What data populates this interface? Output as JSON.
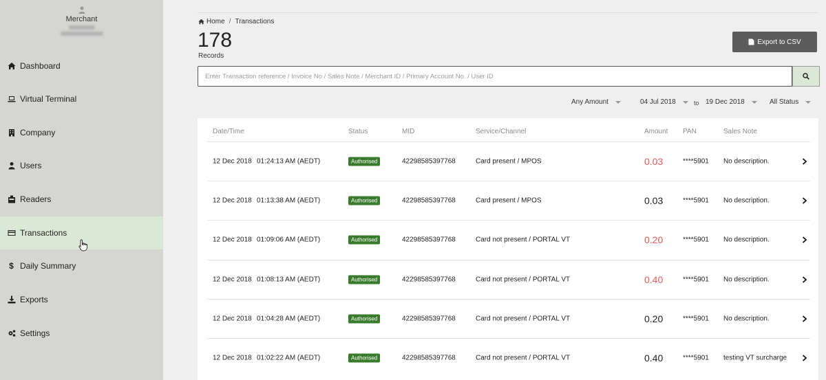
{
  "sidebar": {
    "merchant_title": "Merchant",
    "items": [
      {
        "label": "Dashboard",
        "icon": "home-icon",
        "active": false
      },
      {
        "label": "Virtual Terminal",
        "icon": "laptop-icon",
        "active": false
      },
      {
        "label": "Company",
        "icon": "building-icon",
        "active": false
      },
      {
        "label": "Users",
        "icon": "user-icon",
        "active": false
      },
      {
        "label": "Readers",
        "icon": "reader-icon",
        "active": false
      },
      {
        "label": "Transactions",
        "icon": "credit-card-icon",
        "active": true
      },
      {
        "label": "Daily Summary",
        "icon": "dollar-icon",
        "active": false
      },
      {
        "label": "Exports",
        "icon": "download-icon",
        "active": false
      },
      {
        "label": "Settings",
        "icon": "gears-icon",
        "active": false
      }
    ]
  },
  "breadcrumb": {
    "home": "Home",
    "current": "Transactions"
  },
  "records": {
    "count": "178",
    "label": "Records"
  },
  "export_label": "Export to CSV",
  "search": {
    "placeholder": "Enter Transaction reference / Invoice No / Sales Note / Merchant ID / Primary Account No. / User ID"
  },
  "filters": {
    "amount": "Any Amount",
    "date_from": "04 Jul 2018",
    "to": "to",
    "date_to": "19 Dec 2018",
    "status": "All Status"
  },
  "table": {
    "headers": {
      "datetime": "Date/Time",
      "status": "Status",
      "mid": "MID",
      "service": "Service/Channel",
      "amount": "Amount",
      "pan": "PAN",
      "note": "Sales Note"
    },
    "rows": [
      {
        "date": "12 Dec 2018",
        "time": "01:24:13 AM (AEDT)",
        "status": "Authorised",
        "mid": "42298585397768",
        "service": "Card present / MPOS",
        "amount": "0.03",
        "red": true,
        "pan": "****5901",
        "note": "No description."
      },
      {
        "date": "12 Dec 2018",
        "time": "01:13:38 AM (AEDT)",
        "status": "Authorised",
        "mid": "42298585397768",
        "service": "Card present / MPOS",
        "amount": "0.03",
        "red": false,
        "pan": "****5901",
        "note": "No description."
      },
      {
        "date": "12 Dec 2018",
        "time": "01:09:06 AM (AEDT)",
        "status": "Authorised",
        "mid": "42298585397768",
        "service": "Card not present / PORTAL VT",
        "amount": "0.20",
        "red": true,
        "pan": "****5901",
        "note": "No description."
      },
      {
        "date": "12 Dec 2018",
        "time": "01:08:13 AM (AEDT)",
        "status": "Authorised",
        "mid": "42298585397768",
        "service": "Card not present / PORTAL VT",
        "amount": "0.40",
        "red": true,
        "pan": "****5901",
        "note": "No description."
      },
      {
        "date": "12 Dec 2018",
        "time": "01:04:28 AM (AEDT)",
        "status": "Authorised",
        "mid": "42298585397768",
        "service": "Card not present / PORTAL VT",
        "amount": "0.20",
        "red": false,
        "pan": "****5901",
        "note": "No description."
      },
      {
        "date": "12 Dec 2018",
        "time": "01:02:22 AM (AEDT)",
        "status": "Authorised",
        "mid": "42298585397768",
        "service": "Card not present / PORTAL VT",
        "amount": "0.40",
        "red": false,
        "pan": "****5901",
        "note": "testing VT surcharge"
      }
    ]
  },
  "colors": {
    "accent": "#dbe8d5",
    "badge": "#3a7a2c",
    "amount_red": "#e05a5a"
  }
}
